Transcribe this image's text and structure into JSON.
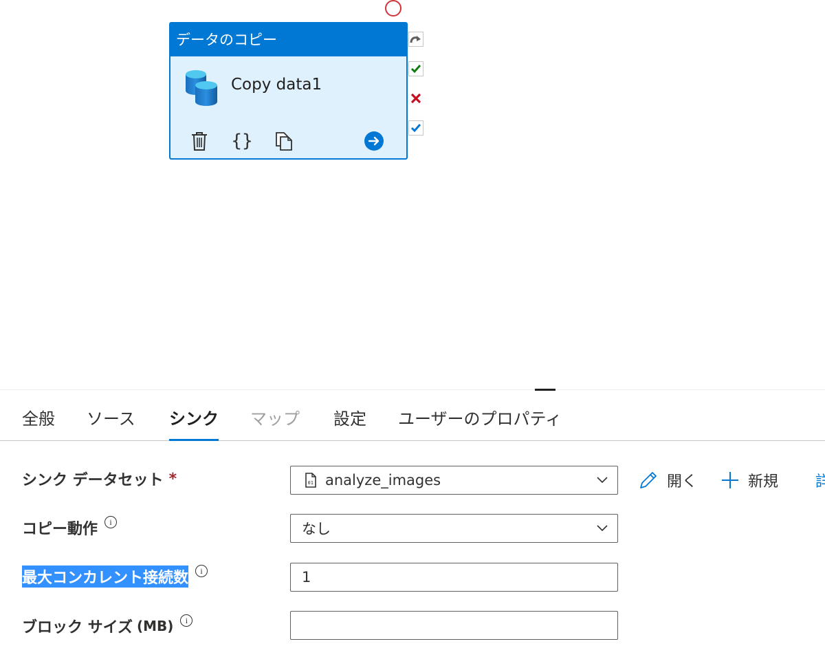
{
  "canvas": {
    "activity": {
      "type_label": "データのコピー",
      "name": "Copy data1"
    },
    "side_icons": [
      "redo-arrow-icon",
      "success-check-icon",
      "failure-x-icon",
      "completion-check-icon"
    ]
  },
  "tabs": [
    {
      "label": "全般",
      "state": "normal"
    },
    {
      "label": "ソース",
      "state": "normal"
    },
    {
      "label": "シンク",
      "state": "active"
    },
    {
      "label": "マップ",
      "state": "disabled"
    },
    {
      "label": "設定",
      "state": "normal"
    },
    {
      "label": "ユーザーのプロパティ",
      "state": "normal"
    }
  ],
  "form": {
    "sink_dataset": {
      "label": "シンク データセット",
      "required_mark": "*",
      "value": "analyze_images"
    },
    "copy_behavior": {
      "label": "コピー動作",
      "value": "なし"
    },
    "max_concurrent": {
      "label": "最大コンカレント接続数",
      "value": "1"
    },
    "block_size": {
      "label": "ブロック サイズ",
      "label_suffix": "(MB)",
      "value": ""
    },
    "info_glyph": "i"
  },
  "actions": {
    "open_label": "開く",
    "new_label": "新規",
    "more_label": "詳"
  },
  "colors": {
    "accent": "#0078d4",
    "activity_bg": "#dff1fc",
    "highlight": "#3390ff",
    "required": "#a4262c"
  }
}
